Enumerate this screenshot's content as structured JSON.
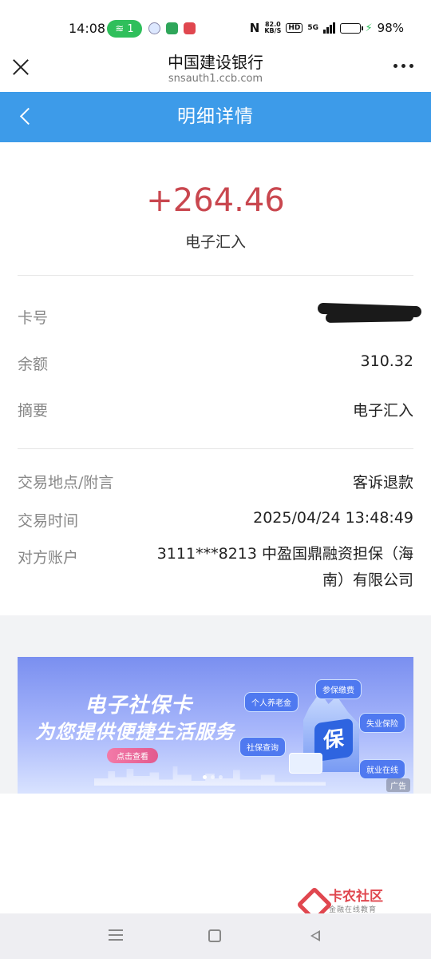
{
  "status_bar": {
    "time": "14:08",
    "hotspot_count": "1",
    "net_speed_value": "82.0",
    "net_speed_unit": "KB/S",
    "hd_label": "HD",
    "network_label": "5G",
    "battery": "98%",
    "battery_level": 0.98
  },
  "browser": {
    "title": "中国建设银行",
    "url": "snsauth1.ccb.com"
  },
  "nav": {
    "title": "明细详情",
    "color": "#3d9be9"
  },
  "transaction": {
    "amount": "+264.46",
    "amount_color": "#c9474f",
    "type": "电子汇入",
    "card_label": "卡号",
    "balance_label": "余额",
    "balance_value": "310.32",
    "summary_label": "摘要",
    "summary_value": "电子汇入",
    "location_label": "交易地点/附言",
    "location_value": "客诉退款",
    "time_label": "交易时间",
    "time_value": "2025/04/24 13:48:49",
    "counterparty_label": "对方账户",
    "counterparty_value": "3111***8213  中盈国鼎融资担保（海南）有限公司"
  },
  "banner": {
    "title_line1": "电子社保卡",
    "title_line2": "为您提供便捷生活服务",
    "button": "点击查看",
    "tags": [
      "个人养老金",
      "参保缴费",
      "失业保险",
      "社保查询",
      "就业在线"
    ],
    "icon_text": "保",
    "ad_label": "广告"
  },
  "watermark": {
    "name": "卡农社区",
    "slogan": "金融在线教育"
  }
}
